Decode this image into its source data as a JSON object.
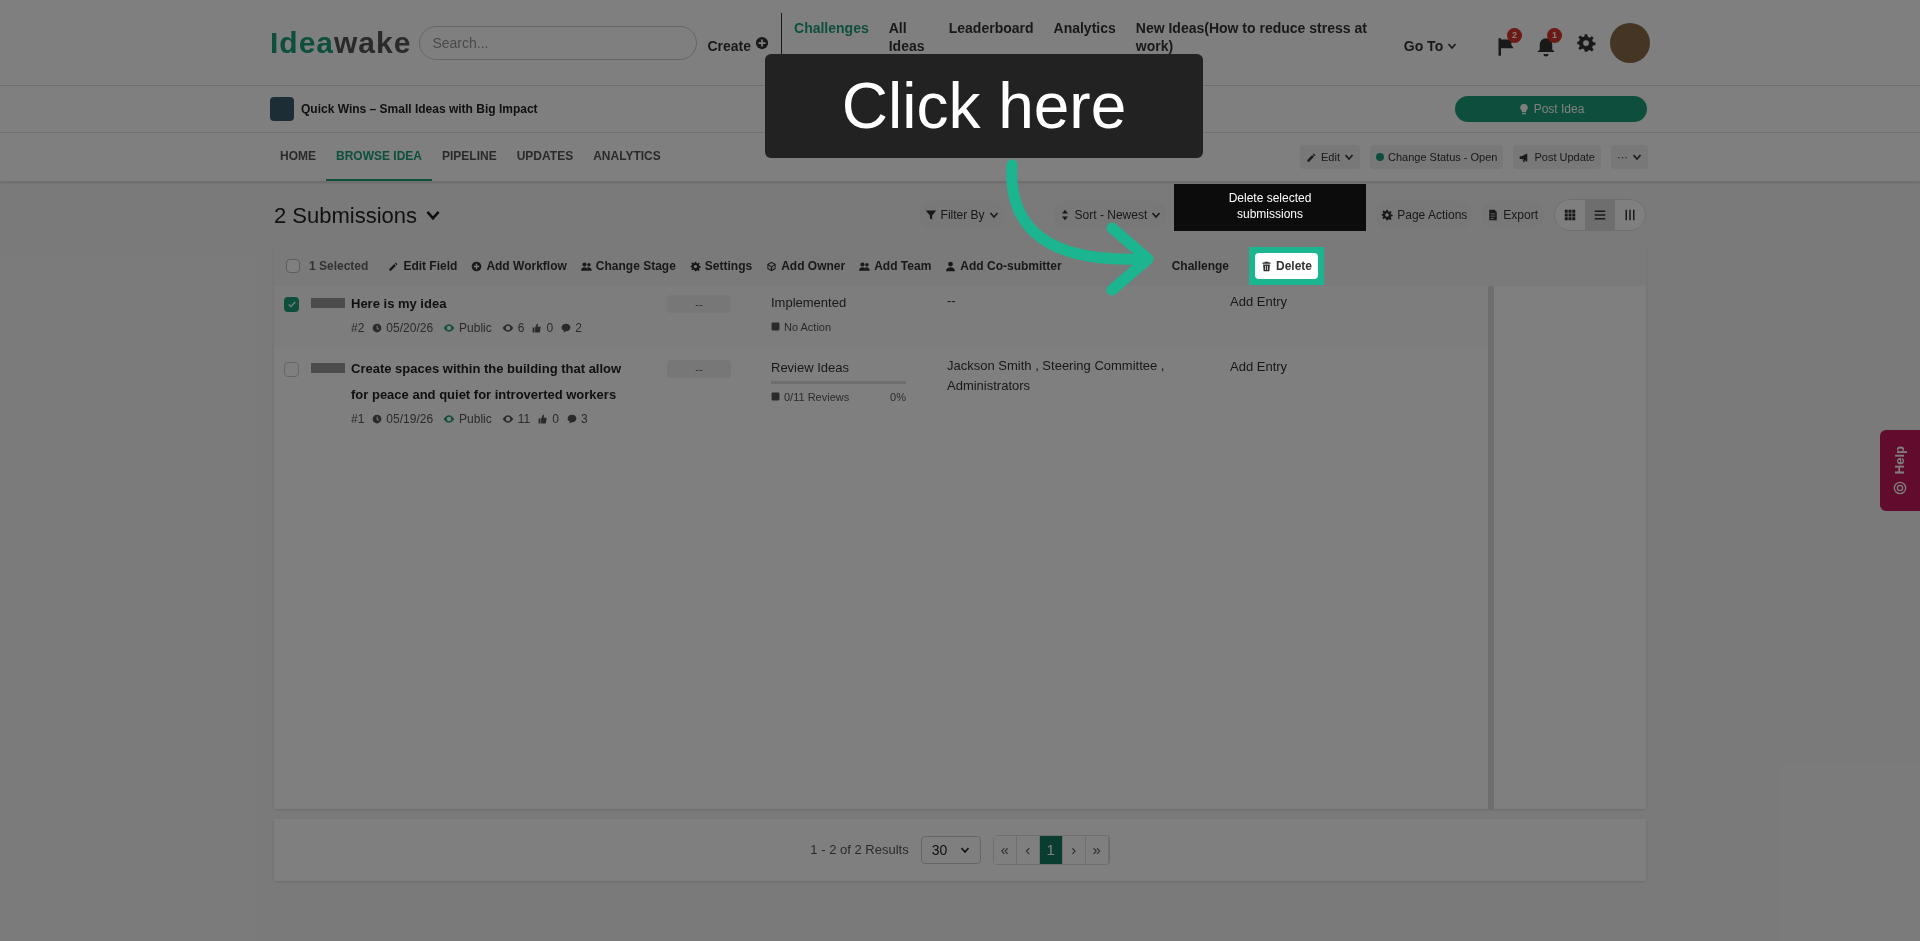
{
  "header": {
    "logo": {
      "first": "Idea",
      "second": "wake"
    },
    "search": {
      "placeholder": "Search..."
    },
    "nav": [
      {
        "kind": "create",
        "label": "Create",
        "selected": false
      },
      {
        "kind": "link",
        "label": "Challenges",
        "selected": true
      },
      {
        "kind": "link",
        "label": "All Ideas",
        "selected": false
      },
      {
        "kind": "link",
        "label": "Leaderboard",
        "selected": false
      },
      {
        "kind": "link",
        "label": "Analytics",
        "selected": false
      },
      {
        "kind": "link",
        "label": "New Ideas(How to reduce stress at work)",
        "selected": false
      },
      {
        "kind": "menu",
        "label": "Go To",
        "selected": false
      }
    ],
    "notifications": [
      {
        "kind": "flag",
        "count": "2"
      },
      {
        "kind": "bell",
        "count": "1"
      }
    ]
  },
  "challenge": {
    "title": "Quick Wins – Small Ideas with Big Impact",
    "post_button": "Post Idea"
  },
  "tabs": [
    {
      "label": "HOME",
      "selected": false
    },
    {
      "label": "BROWSE IDEA",
      "selected": true
    },
    {
      "label": "PIPELINE",
      "selected": false
    },
    {
      "label": "UPDATES",
      "selected": false
    },
    {
      "label": "ANALYTICS",
      "selected": false
    }
  ],
  "tab_actions": [
    {
      "kind": "edit",
      "label": "Edit"
    },
    {
      "kind": "status",
      "label": "Change Status - Open"
    },
    {
      "kind": "megaphone",
      "label": "Post Update"
    },
    {
      "kind": "more",
      "label": "···"
    }
  ],
  "submissions": {
    "title": "2 Submissions",
    "controls": [
      {
        "kind": "filter",
        "label": "Filter By"
      },
      {
        "kind": "sort",
        "label": "Sort - Newest"
      },
      {
        "kind": "gear",
        "label": "Page Actions"
      },
      {
        "kind": "export",
        "label": "Export"
      }
    ],
    "views": [
      {
        "kind": "grid",
        "selected": false
      },
      {
        "kind": "list",
        "selected": true
      },
      {
        "kind": "columns",
        "selected": false
      }
    ]
  },
  "bulk_bar": {
    "select_all_checked": false,
    "selected_label": "1 Selected",
    "actions": [
      {
        "kind": "edit",
        "label": "Edit Field",
        "highlighted": false
      },
      {
        "kind": "plus",
        "label": "Add Workflow",
        "highlighted": false
      },
      {
        "kind": "people",
        "label": "Change Stage",
        "highlighted": false
      },
      {
        "kind": "gear",
        "label": "Settings",
        "highlighted": false
      },
      {
        "kind": "cube",
        "label": "Add Owner",
        "highlighted": false
      },
      {
        "kind": "people",
        "label": "Add Team",
        "highlighted": false
      },
      {
        "kind": "person",
        "label": "Add Co-submitter",
        "highlighted": false
      },
      {
        "kind": "plain",
        "label": "Challenge",
        "highlighted": false
      },
      {
        "kind": "trash",
        "label": "Delete",
        "highlighted": true
      }
    ]
  },
  "rows": [
    {
      "checked": true,
      "title": "Here is my idea",
      "number": "#2",
      "date": "05/20/26",
      "visibility": "Public",
      "views": "6",
      "likes": "0",
      "comments": "2",
      "score": "--",
      "stage": "Implemented",
      "stage_detail": {
        "kind": "action",
        "label": "No Action"
      },
      "assignees": "--",
      "entry": "Add Entry"
    },
    {
      "checked": false,
      "title": "Create spaces within the building that allow for peace and quiet for introverted workers",
      "number": "#1",
      "date": "05/19/26",
      "visibility": "Public",
      "views": "11",
      "likes": "0",
      "comments": "3",
      "score": "--",
      "stage": "Review Ideas",
      "stage_detail": {
        "kind": "progress",
        "level": 0,
        "label": "0/11 Reviews",
        "percent": "0%"
      },
      "assignees": "Jackson Smith , Steering Committee , Administrators",
      "entry": "Add Entry"
    }
  ],
  "pagination": {
    "summary": "1 - 2 of 2 Results",
    "page_size": "30",
    "buttons": [
      {
        "label": "«",
        "selected": false
      },
      {
        "label": "‹",
        "selected": false
      },
      {
        "label": "1",
        "selected": true
      },
      {
        "label": "›",
        "selected": false
      },
      {
        "label": "»",
        "selected": false
      }
    ]
  },
  "help": {
    "label": "Help"
  },
  "tutorial": {
    "callout": "Click here",
    "tooltip": "Delete selected submissions"
  }
}
